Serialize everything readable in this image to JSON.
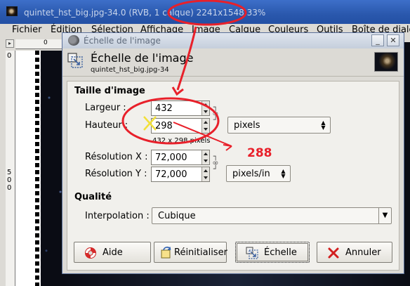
{
  "bg_window": {
    "title": "quintet_hst_big.jpg-34.0 (RVB, 1 calque) 2241x1548 33%",
    "menu": [
      "Fichier",
      "Édition",
      "Sélection",
      "Affichage",
      "Image",
      "Calque",
      "Couleurs",
      "Outils",
      "Boîte de dialo"
    ],
    "ruler_top_label": "0",
    "ruler_left_top": "0",
    "ruler_left_mid": "500"
  },
  "dialog": {
    "title": "Échelle de l'image",
    "header_title": "Échelle de l'image",
    "header_subtitle": "quintet_hst_big.jpg-34",
    "section_size": "Taille d'image",
    "width_label": "Largeur :",
    "width_value": "432",
    "height_label": "Hauteur :",
    "height_value": "298",
    "size_hint": "432 x 298 pixels",
    "unit": "pixels",
    "res_x_label": "Résolution X :",
    "res_x_value": "72,000",
    "res_y_label": "Résolution Y :",
    "res_y_value": "72,000",
    "res_unit": "pixels/in",
    "section_quality": "Qualité",
    "interp_label": "Interpolation :",
    "interp_value": "Cubique",
    "buttons": {
      "help": "Aide",
      "reset": "Réinitialiser",
      "scale": "Échelle",
      "cancel": "Annuler"
    },
    "titlebar_buttons": {
      "minimize": "_",
      "close": "✕"
    }
  },
  "annotations": {
    "corrected_value": "288",
    "color": "#e8202a"
  }
}
